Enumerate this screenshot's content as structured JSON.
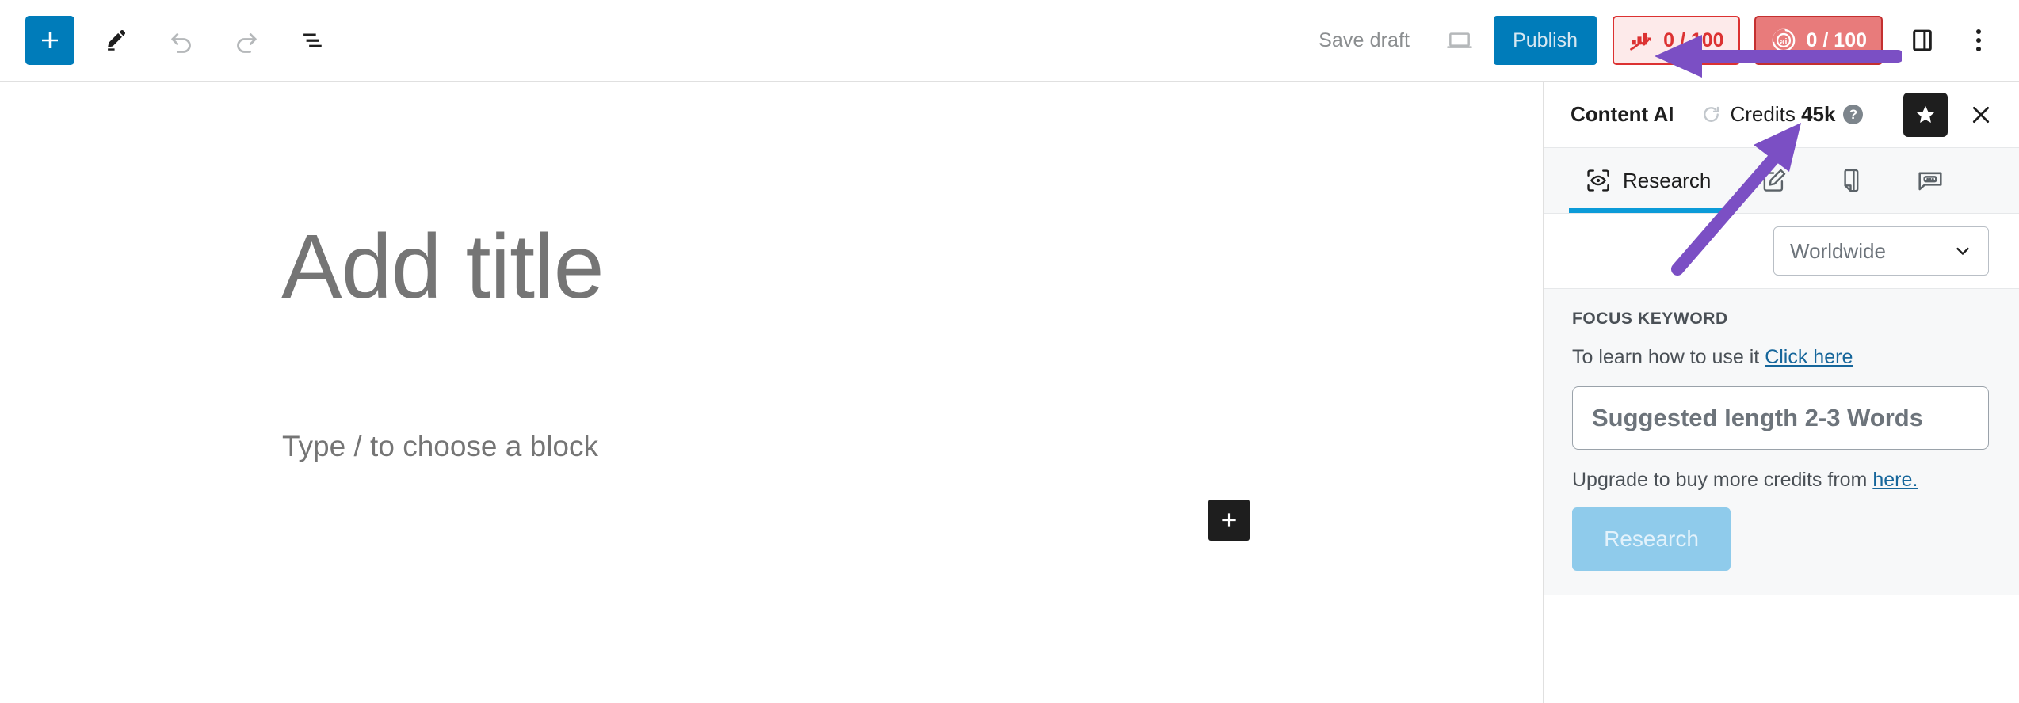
{
  "toolbar": {
    "add_block_label": "+",
    "icons": [
      "add-block-icon",
      "edit-tool-icon",
      "undo-icon",
      "redo-icon",
      "list-view-icon"
    ],
    "save_draft_label": "Save draft",
    "preview_icon": "preview-desktop-icon",
    "publish_label": "Publish",
    "seo_score": "0 / 100",
    "ai_score": "0 / 100",
    "sidebar_toggle_icon": "settings-sidebar-icon",
    "kebab_icon": "more-options-icon"
  },
  "editor": {
    "title_placeholder": "Add title",
    "block_placeholder": "Type / to choose a block",
    "inline_add_label": "+"
  },
  "sidebar": {
    "title": "Content AI",
    "credits_label": "Credits",
    "credits_value": "45k",
    "help_badge": "?",
    "star_icon": "star-icon",
    "close_icon": "close-icon",
    "refresh_icon": "refresh-icon",
    "tabs": [
      {
        "label": "Research",
        "icon": "research-eye-icon",
        "active": true
      },
      {
        "label": "",
        "icon": "write-pencil-icon",
        "active": false
      },
      {
        "label": "",
        "icon": "document-pen-icon",
        "active": false
      },
      {
        "label": "",
        "icon": "chat-dots-icon",
        "active": false
      }
    ],
    "region": {
      "selected": "Worldwide",
      "chevron_icon": "chevron-down-icon"
    },
    "focus_keyword": {
      "section_title": "FOCUS KEYWORD",
      "learn_text": "To learn how to use it ",
      "learn_link": "Click here",
      "input_placeholder": "Suggested length 2-3 Words",
      "input_value": "",
      "upgrade_text": "Upgrade to buy more credits from ",
      "upgrade_link": "here.",
      "research_button": "Research"
    }
  },
  "colors": {
    "brand_blue": "#007cba",
    "seo_red": "#dc3232",
    "ai_red": "#e87b7b",
    "tab_underline": "#0b9bd8",
    "annotation_purple": "#7b4fc4"
  },
  "annotations": [
    {
      "name": "arrow-to-sidebar-toggle",
      "direction": "left"
    },
    {
      "name": "arrow-to-credits",
      "direction": "up-right"
    }
  ]
}
